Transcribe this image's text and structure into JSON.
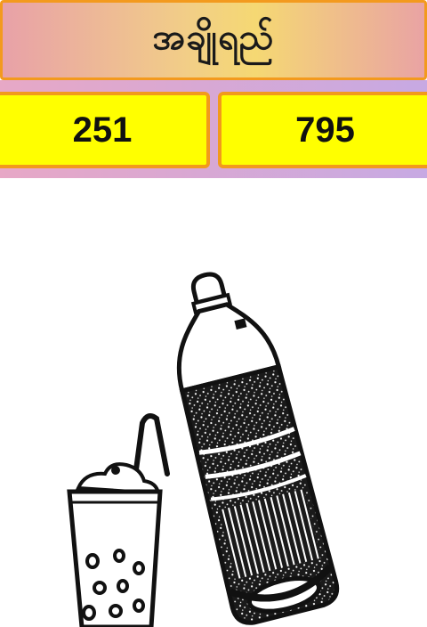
{
  "header": {
    "title": "အချိုရည်"
  },
  "scores": {
    "left": "251",
    "right": "795"
  },
  "illustration": {
    "items": [
      "cup-with-straw",
      "bottle"
    ],
    "ink_color": "#111111"
  },
  "colors": {
    "title_border": "#f39a1e",
    "score_fill": "#ffff00",
    "score_border": "#f29a1c"
  }
}
